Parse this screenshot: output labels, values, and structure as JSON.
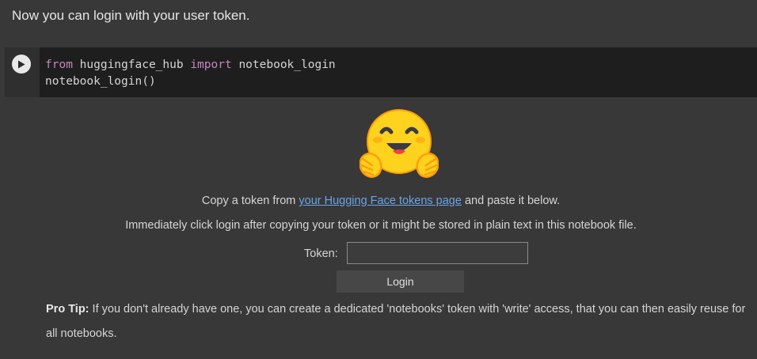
{
  "intro_text": "Now you can login with your user token.",
  "code_cell": {
    "line1": {
      "kw_from": "from",
      "module": " huggingface_hub ",
      "kw_import": "import",
      "name": " notebook_login"
    },
    "line2": "notebook_login()"
  },
  "output": {
    "logo_icon": "hugging-face-emoji-icon",
    "copy_prefix": "Copy a token from ",
    "copy_link": "your Hugging Face tokens page",
    "copy_suffix": " and paste it below.",
    "warning": "Immediately click login after copying your token or it might be stored in plain text in this notebook file.",
    "token_label": "Token:",
    "token_value": "",
    "login_label": "Login",
    "tip_title": "Pro Tip:",
    "tip_text": " If you don't already have one, you can create a dedicated 'notebooks' token with 'write' access, that you can then easily reuse for all notebooks."
  },
  "colors": {
    "background": "#383838",
    "code_background": "#1e1e1e",
    "keyword": "#c586c0",
    "link": "#6aa4e8"
  }
}
